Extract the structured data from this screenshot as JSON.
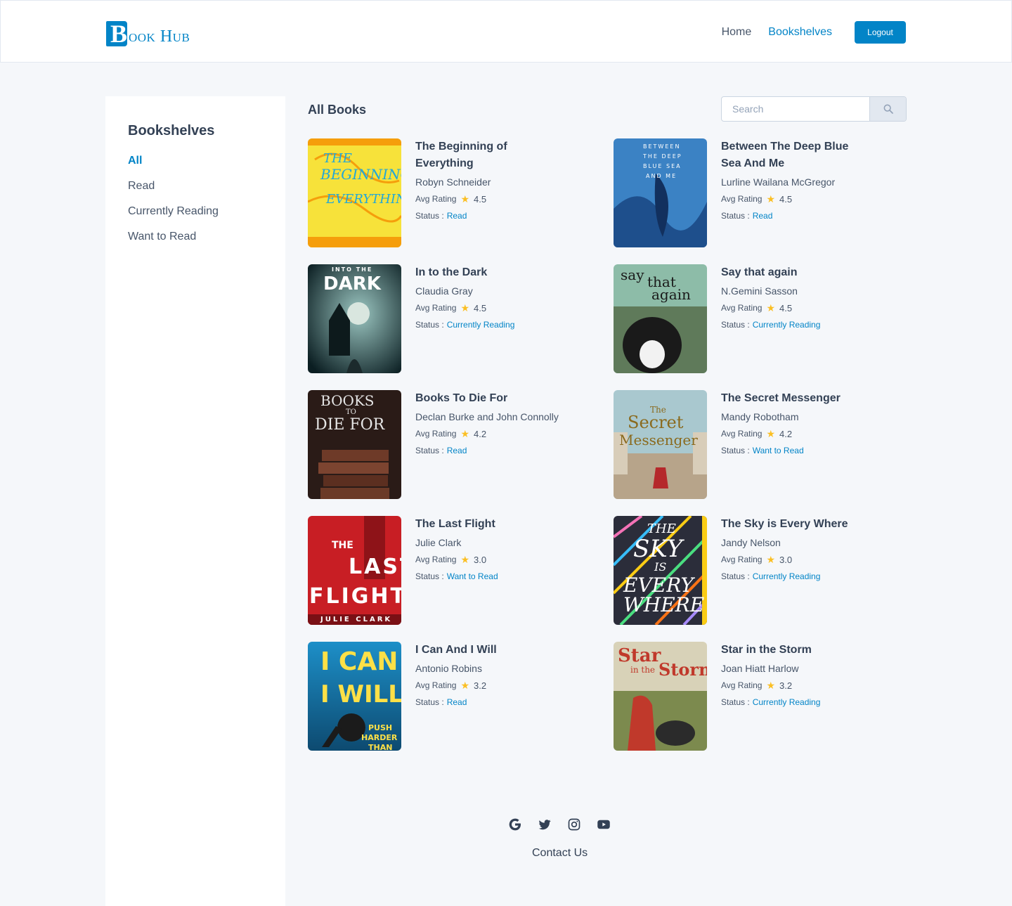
{
  "header": {
    "logo_text": "ook Hub",
    "logo_letter": "B",
    "nav": {
      "home": "Home",
      "bookshelves": "Bookshelves",
      "logout": "Logout"
    },
    "accent": "#0284c7"
  },
  "sidebar": {
    "title": "Bookshelves",
    "items": [
      {
        "label": "All",
        "active": true
      },
      {
        "label": "Read",
        "active": false
      },
      {
        "label": "Currently Reading",
        "active": false
      },
      {
        "label": "Want to Read",
        "active": false
      }
    ]
  },
  "main": {
    "title": "All Books",
    "search": {
      "placeholder": "Search",
      "icon": "search-icon"
    },
    "rating_label": "Avg Rating",
    "status_label": "Status :",
    "books": [
      {
        "title": "The Beginning of Everything",
        "author": "Robyn Schneider",
        "rating": "4.5",
        "status": "Read"
      },
      {
        "title": "Between The Deep Blue Sea And Me",
        "author": "Lurline Wailana McGregor",
        "rating": "4.5",
        "status": "Read"
      },
      {
        "title": "In to the Dark",
        "author": "Claudia Gray",
        "rating": "4.5",
        "status": "Currently Reading"
      },
      {
        "title": "Say that again",
        "author": "N.Gemini Sasson",
        "rating": "4.5",
        "status": "Currently Reading"
      },
      {
        "title": "Books To Die For",
        "author": "Declan Burke and John Connolly",
        "rating": "4.2",
        "status": "Read"
      },
      {
        "title": "The Secret Messenger",
        "author": "Mandy Robotham",
        "rating": "4.2",
        "status": "Want to Read"
      },
      {
        "title": "The Last Flight",
        "author": "Julie Clark",
        "rating": "3.0",
        "status": "Want to Read"
      },
      {
        "title": "The Sky is Every Where",
        "author": "Jandy Nelson",
        "rating": "3.0",
        "status": "Currently Reading"
      },
      {
        "title": "I Can And I Will",
        "author": "Antonio Robins",
        "rating": "3.2",
        "status": "Read"
      },
      {
        "title": "Star in the Storm",
        "author": "Joan Hiatt Harlow",
        "rating": "3.2",
        "status": "Currently Reading"
      }
    ]
  },
  "footer": {
    "icons": [
      "google-icon",
      "twitter-icon",
      "instagram-icon",
      "youtube-icon"
    ],
    "contact": "Contact Us"
  }
}
